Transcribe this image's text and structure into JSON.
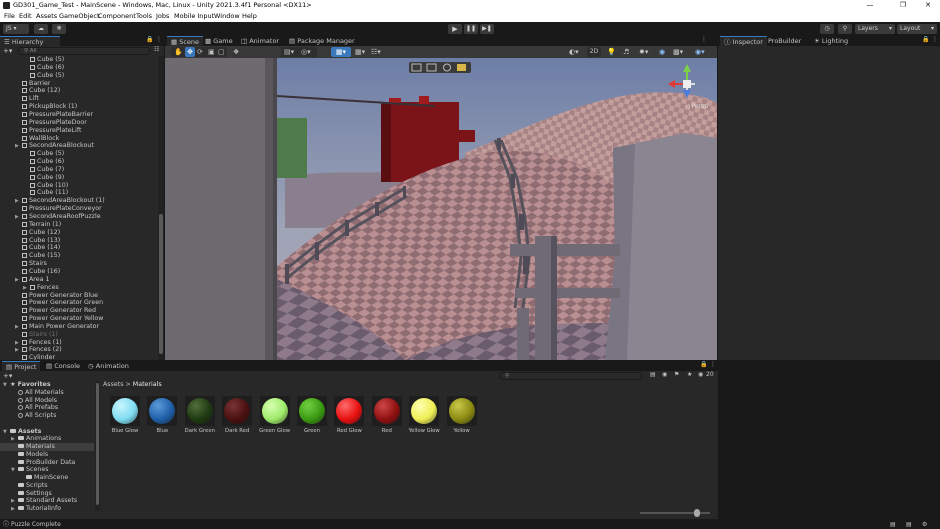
{
  "window": {
    "title": "GD301_Game_Test - MainScene - Windows, Mac, Linux - Unity 2021.3.4f1 Personal <DX11>"
  },
  "menu": [
    "File",
    "Edit",
    "Assets",
    "GameObject",
    "Component",
    "Tools",
    "Jobs",
    "Mobile Input",
    "Window",
    "Help"
  ],
  "toolbar": {
    "account": "JS",
    "layers": "Layers",
    "layout": "Layout"
  },
  "hierarchy": {
    "tab": "Hierarchy",
    "search_placeholder": "All",
    "rows": [
      {
        "label": "Cube (5)",
        "indent": 2,
        "fold": false,
        "dim": false
      },
      {
        "label": "Cube (6)",
        "indent": 2,
        "fold": false,
        "dim": false
      },
      {
        "label": "Cube (5)",
        "indent": 2,
        "fold": false,
        "dim": false
      },
      {
        "label": "Barrier",
        "indent": 1,
        "fold": false,
        "dim": false
      },
      {
        "label": "Cube (12)",
        "indent": 1,
        "fold": false,
        "dim": false
      },
      {
        "label": "Lift",
        "indent": 1,
        "fold": false,
        "dim": false
      },
      {
        "label": "PickupBlock (1)",
        "indent": 1,
        "fold": false,
        "dim": false
      },
      {
        "label": "PressurePlateBarrier",
        "indent": 1,
        "fold": false,
        "dim": false
      },
      {
        "label": "PressurePlateDoor",
        "indent": 1,
        "fold": false,
        "dim": false
      },
      {
        "label": "PressurePlateLift",
        "indent": 1,
        "fold": false,
        "dim": false
      },
      {
        "label": "WallBlock",
        "indent": 1,
        "fold": false,
        "dim": false
      },
      {
        "label": "SecondAreaBlockout",
        "indent": 1,
        "fold": true,
        "dim": false
      },
      {
        "label": "Cube (5)",
        "indent": 2,
        "fold": false,
        "dim": false
      },
      {
        "label": "Cube (6)",
        "indent": 2,
        "fold": false,
        "dim": false
      },
      {
        "label": "Cube (7)",
        "indent": 2,
        "fold": false,
        "dim": false
      },
      {
        "label": "Cube (9)",
        "indent": 2,
        "fold": false,
        "dim": false
      },
      {
        "label": "Cube (10)",
        "indent": 2,
        "fold": false,
        "dim": false
      },
      {
        "label": "Cube (11)",
        "indent": 2,
        "fold": false,
        "dim": false
      },
      {
        "label": "SecondAreaBlockout (1)",
        "indent": 1,
        "fold": true,
        "dim": false
      },
      {
        "label": "PressurePlateConveyor",
        "indent": 1,
        "fold": false,
        "dim": false
      },
      {
        "label": "SecondAreaRoofPuzzle",
        "indent": 1,
        "fold": true,
        "dim": false
      },
      {
        "label": "Terrain (1)",
        "indent": 1,
        "fold": false,
        "dim": false
      },
      {
        "label": "Cube (12)",
        "indent": 1,
        "fold": false,
        "dim": false
      },
      {
        "label": "Cube (13)",
        "indent": 1,
        "fold": false,
        "dim": false
      },
      {
        "label": "Cube (14)",
        "indent": 1,
        "fold": false,
        "dim": false
      },
      {
        "label": "Cube (15)",
        "indent": 1,
        "fold": false,
        "dim": false
      },
      {
        "label": "Stairs",
        "indent": 1,
        "fold": false,
        "dim": false
      },
      {
        "label": "Cube (16)",
        "indent": 1,
        "fold": false,
        "dim": false
      },
      {
        "label": "Area 1",
        "indent": 1,
        "fold": true,
        "dim": false
      },
      {
        "label": "Fences",
        "indent": 2,
        "fold": true,
        "dim": false
      },
      {
        "label": "Power Generator Blue",
        "indent": 1,
        "fold": false,
        "dim": false
      },
      {
        "label": "Power Generator Green",
        "indent": 1,
        "fold": false,
        "dim": false
      },
      {
        "label": "Power Generator Red",
        "indent": 1,
        "fold": false,
        "dim": false
      },
      {
        "label": "Power Generator Yellow",
        "indent": 1,
        "fold": false,
        "dim": false
      },
      {
        "label": "Main Power Generator",
        "indent": 1,
        "fold": true,
        "dim": false
      },
      {
        "label": "Stairs (1)",
        "indent": 1,
        "fold": false,
        "dim": true
      },
      {
        "label": "Fences (1)",
        "indent": 1,
        "fold": true,
        "dim": false
      },
      {
        "label": "Fences (2)",
        "indent": 1,
        "fold": true,
        "dim": false
      },
      {
        "label": "Cylinder",
        "indent": 1,
        "fold": false,
        "dim": false
      }
    ]
  },
  "scene": {
    "tabs": [
      "Scene",
      "Game",
      "Animator",
      "Package Manager"
    ],
    "mode_2d": "2D",
    "persp": "◁"
  },
  "inspector": {
    "tabs": [
      "Inspector",
      "ProBuilder",
      "Lighting"
    ]
  },
  "project": {
    "tabs": [
      "Project",
      "Console",
      "Animation"
    ],
    "breadcrumb": [
      "Assets",
      "Materials"
    ],
    "count": "20",
    "tree": [
      {
        "label": "Favorites",
        "indent": 0,
        "kind": "star",
        "bold": true
      },
      {
        "label": "All Materials",
        "indent": 1,
        "kind": "search",
        "bold": false
      },
      {
        "label": "All Models",
        "indent": 1,
        "kind": "search",
        "bold": false
      },
      {
        "label": "All Prefabs",
        "indent": 1,
        "kind": "search",
        "bold": false
      },
      {
        "label": "All Scripts",
        "indent": 1,
        "kind": "search",
        "bold": false
      },
      {
        "label": "",
        "indent": 0,
        "kind": "gap",
        "bold": false
      },
      {
        "label": "Assets",
        "indent": 0,
        "kind": "folder",
        "bold": true
      },
      {
        "label": "Animations",
        "indent": 1,
        "kind": "folder",
        "bold": false
      },
      {
        "label": "Materials",
        "indent": 1,
        "kind": "folder",
        "bold": false,
        "selected": true
      },
      {
        "label": "Models",
        "indent": 1,
        "kind": "folder",
        "bold": false
      },
      {
        "label": "ProBuilder Data",
        "indent": 1,
        "kind": "folder",
        "bold": false
      },
      {
        "label": "Scenes",
        "indent": 1,
        "kind": "folder",
        "bold": false
      },
      {
        "label": "MainScene",
        "indent": 2,
        "kind": "folder",
        "bold": false
      },
      {
        "label": "Scripts",
        "indent": 1,
        "kind": "folder",
        "bold": false
      },
      {
        "label": "Settings",
        "indent": 1,
        "kind": "folder",
        "bold": false
      },
      {
        "label": "Standard Assets",
        "indent": 1,
        "kind": "folder",
        "bold": false
      },
      {
        "label": "TutorialInfo",
        "indent": 1,
        "kind": "folder",
        "bold": false
      },
      {
        "label": "Packages",
        "indent": 0,
        "kind": "folder",
        "bold": false
      }
    ],
    "materials": [
      {
        "name": "Blue Glow",
        "color": "#7fdcf0",
        "hi": "#c8f4ff"
      },
      {
        "name": "Blue",
        "color": "#1f5fa8",
        "hi": "#5b9ad8"
      },
      {
        "name": "Dark Green",
        "color": "#1f3a12",
        "hi": "#4f6f3a"
      },
      {
        "name": "Dark Red",
        "color": "#4a1010",
        "hi": "#7a3434"
      },
      {
        "name": "Green Glow",
        "color": "#9eea6a",
        "hi": "#d8ffb0"
      },
      {
        "name": "Green",
        "color": "#3a9a12",
        "hi": "#72cf42"
      },
      {
        "name": "Red Glow",
        "color": "#e81010",
        "hi": "#ff6a6a"
      },
      {
        "name": "Red",
        "color": "#8e1010",
        "hi": "#cf4747"
      },
      {
        "name": "Yellow Glow",
        "color": "#eeee55",
        "hi": "#ffffb0"
      },
      {
        "name": "Yellow",
        "color": "#8a8a12",
        "hi": "#c8c84a"
      }
    ]
  },
  "status": {
    "message": "Puzzle Complete"
  }
}
